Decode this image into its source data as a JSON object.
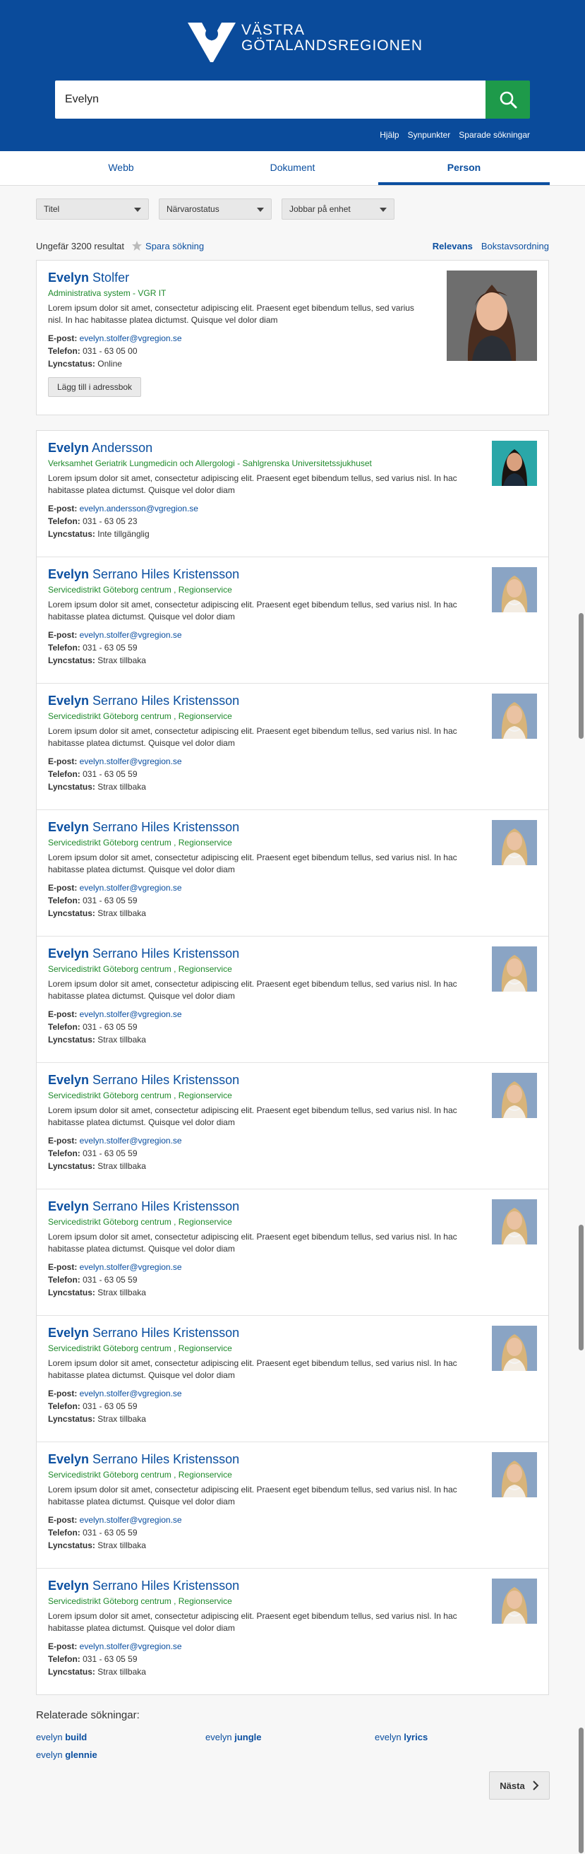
{
  "brand": {
    "line1": "VÄSTRA",
    "line2": "GÖTALANDSREGIONEN"
  },
  "search": {
    "value": "Evelyn"
  },
  "header_links": [
    "Hjälp",
    "Synpunkter",
    "Sparade sökningar"
  ],
  "tabs": [
    {
      "label": "Webb",
      "active": false
    },
    {
      "label": "Dokument",
      "active": false
    },
    {
      "label": "Person",
      "active": true
    }
  ],
  "filters": [
    "Titel",
    "Närvarostatus",
    "Jobbar på enhet"
  ],
  "results": {
    "count": "Ungefär 3200 resultat",
    "save_label": "Spara sökning",
    "sort_relevance": "Relevans",
    "sort_alpha": "Bokstavsordning"
  },
  "labels": {
    "email": "E-post:",
    "phone": "Telefon:",
    "lync": "Lyncstatus:"
  },
  "featured": {
    "first": "Evelyn",
    "last": " Stolfer",
    "org": "Administrativa system - VGR IT",
    "desc": "Lorem ipsum dolor sit amet, consectetur adipiscing elit. Praesent eget bibendum tellus, sed varius nisl. In hac habitasse platea dictumst. Quisque vel dolor diam",
    "email": "evelyn.stolfer@vgregion.se",
    "phone": "031 - 63 05 00",
    "lync": "Online",
    "button": "Lägg till i adressbok"
  },
  "people": [
    {
      "first": "Evelyn",
      "last": " Andersson",
      "org": "Verksamhet Geriatrik Lungmedicin och Allergologi - Sahlgrenska Universitetssjukhuset",
      "desc": "Lorem ipsum dolor sit amet, consectetur adipiscing elit. Praesent eget bibendum tellus, sed varius nisl. In hac habitasse platea dictumst. Quisque vel dolor diam",
      "email": "evelyn.andersson@vgregion.se",
      "phone": "031 - 63 05 23",
      "lync": "Inte tillgänglig"
    },
    {
      "first": "Evelyn",
      "last": " Serrano Hiles Kristensson",
      "org": "Servicedistrikt Göteborg centrum , Regionservice",
      "desc": "Lorem ipsum dolor sit amet, consectetur adipiscing elit. Praesent eget bibendum tellus, sed varius nisl. In hac habitasse platea dictumst. Quisque vel dolor diam",
      "email": "evelyn.stolfer@vgregion.se",
      "phone": "031 - 63 05 59",
      "lync": "Strax tillbaka"
    },
    {
      "first": "Evelyn",
      "last": " Serrano Hiles Kristensson",
      "org": "Servicedistrikt Göteborg centrum , Regionservice",
      "desc": "Lorem ipsum dolor sit amet, consectetur adipiscing elit. Praesent eget bibendum tellus, sed varius nisl. In hac habitasse platea dictumst. Quisque vel dolor diam",
      "email": "evelyn.stolfer@vgregion.se",
      "phone": "031 - 63 05 59",
      "lync": "Strax tillbaka"
    },
    {
      "first": "Evelyn",
      "last": " Serrano Hiles Kristensson",
      "org": "Servicedistrikt Göteborg centrum , Regionservice",
      "desc": "Lorem ipsum dolor sit amet, consectetur adipiscing elit. Praesent eget bibendum tellus, sed varius nisl. In hac habitasse platea dictumst. Quisque vel dolor diam",
      "email": "evelyn.stolfer@vgregion.se",
      "phone": "031 - 63 05 59",
      "lync": "Strax tillbaka"
    },
    {
      "first": "Evelyn",
      "last": " Serrano Hiles Kristensson",
      "org": "Servicedistrikt Göteborg centrum , Regionservice",
      "desc": "Lorem ipsum dolor sit amet, consectetur adipiscing elit. Praesent eget bibendum tellus, sed varius nisl. In hac habitasse platea dictumst. Quisque vel dolor diam",
      "email": "evelyn.stolfer@vgregion.se",
      "phone": "031 - 63 05 59",
      "lync": "Strax tillbaka"
    },
    {
      "first": "Evelyn",
      "last": " Serrano Hiles Kristensson",
      "org": "Servicedistrikt Göteborg centrum , Regionservice",
      "desc": "Lorem ipsum dolor sit amet, consectetur adipiscing elit. Praesent eget bibendum tellus, sed varius nisl. In hac habitasse platea dictumst. Quisque vel dolor diam",
      "email": "evelyn.stolfer@vgregion.se",
      "phone": "031 - 63 05 59",
      "lync": "Strax tillbaka"
    },
    {
      "first": "Evelyn",
      "last": " Serrano Hiles Kristensson",
      "org": "Servicedistrikt Göteborg centrum , Regionservice",
      "desc": "Lorem ipsum dolor sit amet, consectetur adipiscing elit. Praesent eget bibendum tellus, sed varius nisl. In hac habitasse platea dictumst. Quisque vel dolor diam",
      "email": "evelyn.stolfer@vgregion.se",
      "phone": "031 - 63 05 59",
      "lync": "Strax tillbaka"
    },
    {
      "first": "Evelyn",
      "last": " Serrano Hiles Kristensson",
      "org": "Servicedistrikt Göteborg centrum , Regionservice",
      "desc": "Lorem ipsum dolor sit amet, consectetur adipiscing elit. Praesent eget bibendum tellus, sed varius nisl. In hac habitasse platea dictumst. Quisque vel dolor diam",
      "email": "evelyn.stolfer@vgregion.se",
      "phone": "031 - 63 05 59",
      "lync": "Strax tillbaka"
    },
    {
      "first": "Evelyn",
      "last": " Serrano Hiles Kristensson",
      "org": "Servicedistrikt Göteborg centrum , Regionservice",
      "desc": "Lorem ipsum dolor sit amet, consectetur adipiscing elit. Praesent eget bibendum tellus, sed varius nisl. In hac habitasse platea dictumst. Quisque vel dolor diam",
      "email": "evelyn.stolfer@vgregion.se",
      "phone": "031 - 63 05 59",
      "lync": "Strax tillbaka"
    },
    {
      "first": "Evelyn",
      "last": " Serrano Hiles Kristensson",
      "org": "Servicedistrikt Göteborg centrum , Regionservice",
      "desc": "Lorem ipsum dolor sit amet, consectetur adipiscing elit. Praesent eget bibendum tellus, sed varius nisl. In hac habitasse platea dictumst. Quisque vel dolor diam",
      "email": "evelyn.stolfer@vgregion.se",
      "phone": "031 - 63 05 59",
      "lync": "Strax tillbaka"
    }
  ],
  "related": {
    "title": "Relaterade sökningar:",
    "items": [
      {
        "base": "evelyn",
        "extra": "build"
      },
      {
        "base": "evelyn",
        "extra": "jungle"
      },
      {
        "base": "evelyn",
        "extra": "lyrics"
      },
      {
        "base": "evelyn",
        "extra": "glennie"
      }
    ]
  },
  "next_label": "Nästa"
}
